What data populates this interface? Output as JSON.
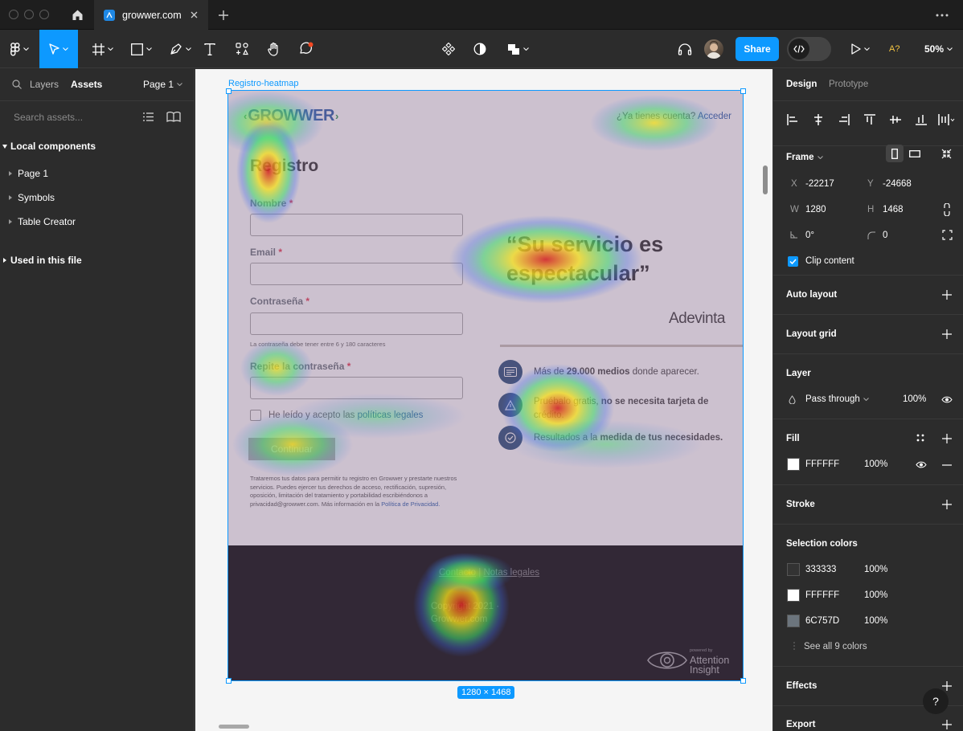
{
  "titlebar": {
    "tab_title": "growwer.com"
  },
  "toolbar": {
    "share_label": "Share",
    "zoom": "50%",
    "a11y_label": "A?"
  },
  "left_panel": {
    "tab_layers": "Layers",
    "tab_assets": "Assets",
    "page_selector": "Page 1",
    "search_placeholder": "Search assets...",
    "local_components": "Local components",
    "components": [
      "Page 1",
      "Symbols",
      "Table Creator"
    ],
    "used_in_file": "Used in this file"
  },
  "canvas": {
    "frame_name": "Registro-heatmap",
    "frame_size_badge": "1280 × 1468",
    "design": {
      "logo": "GROWWER",
      "have_account": "¿Ya tienes cuenta?",
      "login_link": "Acceder",
      "heading": "Registro",
      "name_label": "Nombre",
      "email_label": "Email",
      "password_label": "Contraseña",
      "password_hint": "La contraseña debe tener entre 6 y 180 caracteres",
      "repeat_password_label": "Repite la contraseña",
      "required_mark": "*",
      "terms_text": "He leído y acepto las",
      "terms_link": "políticas legales",
      "continue_button": "Continuar",
      "privacy_text": "Trataremos tus datos para permitir tu registro en Growwer y prestarte nuestros servicios. Puedes ejercer tus derechos de acceso, rectificación, supresión, oposición, limitación del tratamiento y portabilidad escribiéndonos a privacidad@growwer.com. Más información en la",
      "privacy_link": "Política de Privacidad.",
      "quote": "“Su servicio es espectacular”",
      "quote_author": "Adevinta",
      "benefits": [
        {
          "pre": "Más de ",
          "bold": "29.000 medios",
          "post": " donde aparecer."
        },
        {
          "pre": "Pruébalo gratis, ",
          "bold": "no se necesita tarjeta de",
          "post": "crédito."
        },
        {
          "pre": "Resultados a la ",
          "bold": "medida de tus necesidades.",
          "post": ""
        }
      ],
      "footer_contact": "Contacto",
      "footer_separator": "|",
      "footer_legal": "Notas legales",
      "footer_copyright_1": "Copyright 2021 ·",
      "footer_copyright_2": "Growwer.com",
      "powered_by": "powered by",
      "ai_brand_1": "Attention",
      "ai_brand_2": "Insight"
    }
  },
  "right_panel": {
    "tab_design": "Design",
    "tab_prototype": "Prototype",
    "frame_title": "Frame",
    "x_label": "X",
    "x_value": "-22217",
    "y_label": "Y",
    "y_value": "-24668",
    "w_label": "W",
    "w_value": "1280",
    "h_label": "H",
    "h_value": "1468",
    "rotation": "0°",
    "radius": "0",
    "clip_content": "Clip content",
    "auto_layout": "Auto layout",
    "layout_grid": "Layout grid",
    "layer_title": "Layer",
    "blend_mode": "Pass through",
    "layer_opacity": "100%",
    "fill_title": "Fill",
    "fill_hex": "FFFFFF",
    "fill_opacity": "100%",
    "stroke_title": "Stroke",
    "selection_colors_title": "Selection colors",
    "selection_colors": [
      {
        "hex": "333333",
        "opacity": "100%",
        "color": "#333333"
      },
      {
        "hex": "FFFFFF",
        "opacity": "100%",
        "color": "#FFFFFF"
      },
      {
        "hex": "6C757D",
        "opacity": "100%",
        "color": "#6C757D"
      }
    ],
    "see_all_colors": "See all 9 colors",
    "effects_title": "Effects",
    "export_title": "Export",
    "help": "?"
  },
  "colors": {
    "accent": "#0d99ff",
    "growwer_blue": "#2a5caa",
    "growwer_green": "#2e9a54"
  }
}
